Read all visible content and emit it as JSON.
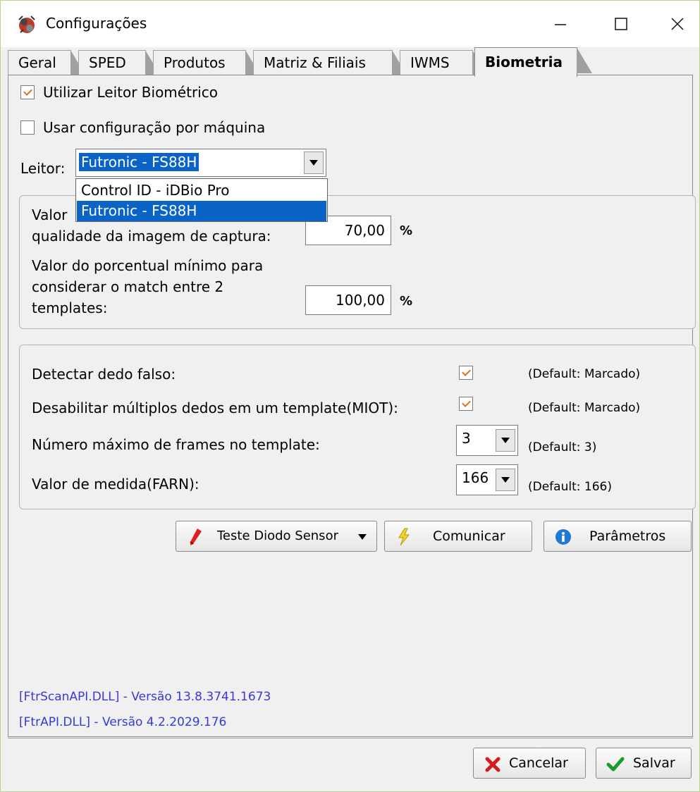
{
  "window": {
    "title": "Configurações"
  },
  "tabs": [
    "Geral",
    "SPED",
    "Produtos",
    "Matriz & Filiais",
    "IWMS",
    "Biometria"
  ],
  "active_tab": "Biometria",
  "options": {
    "use_reader_label": "Utilizar Leitor Biométrico",
    "use_reader_checked": true,
    "per_machine_label": "Usar configuração por máquina",
    "per_machine_checked": false
  },
  "reader": {
    "label": "Leitor:",
    "selected": "Futronic - FS88H",
    "options": [
      "Control ID - iDBio Pro",
      "Futronic - FS88H"
    ]
  },
  "quality": {
    "label_line1": "Valor",
    "label_line2": "qualidade da imagem de captura:",
    "value": "70,00",
    "unit": "%",
    "match_line1": "Valor do porcentual mínimo para",
    "match_line2": "considerar o match entre 2",
    "match_line3": "templates:",
    "match_value": "100,00",
    "match_unit": "%"
  },
  "advanced": {
    "fake_finger_label": "Detectar dedo falso:",
    "fake_finger_checked": true,
    "fake_finger_default": "(Default: Marcado)",
    "miot_label": "Desabilitar múltiplos dedos em um template(MIOT):",
    "miot_checked": true,
    "miot_default": "(Default: Marcado)",
    "frames_label": "Número máximo de frames no template:",
    "frames_value": "3",
    "frames_default": "(Default: 3)",
    "farn_label": "Valor de medida(FARN):",
    "farn_value": "166",
    "farn_default": "(Default: 166)"
  },
  "actions": {
    "test_label": "Teste Diodo Sensor",
    "communicate_label": "Comunicar",
    "params_label": "Parâmetros"
  },
  "versions": {
    "scan_api": "[FtrScanAPI.DLL] - Versão 13.8.3741.1673",
    "ftr_api": "[FtrAPI.DLL] - Versão 4.2.2029.176"
  },
  "footer": {
    "cancel_label": "Cancelar",
    "save_label": "Salvar"
  },
  "colors": {
    "accent": "#0a64c8",
    "link": "#3838d8",
    "check": "#e07020"
  }
}
